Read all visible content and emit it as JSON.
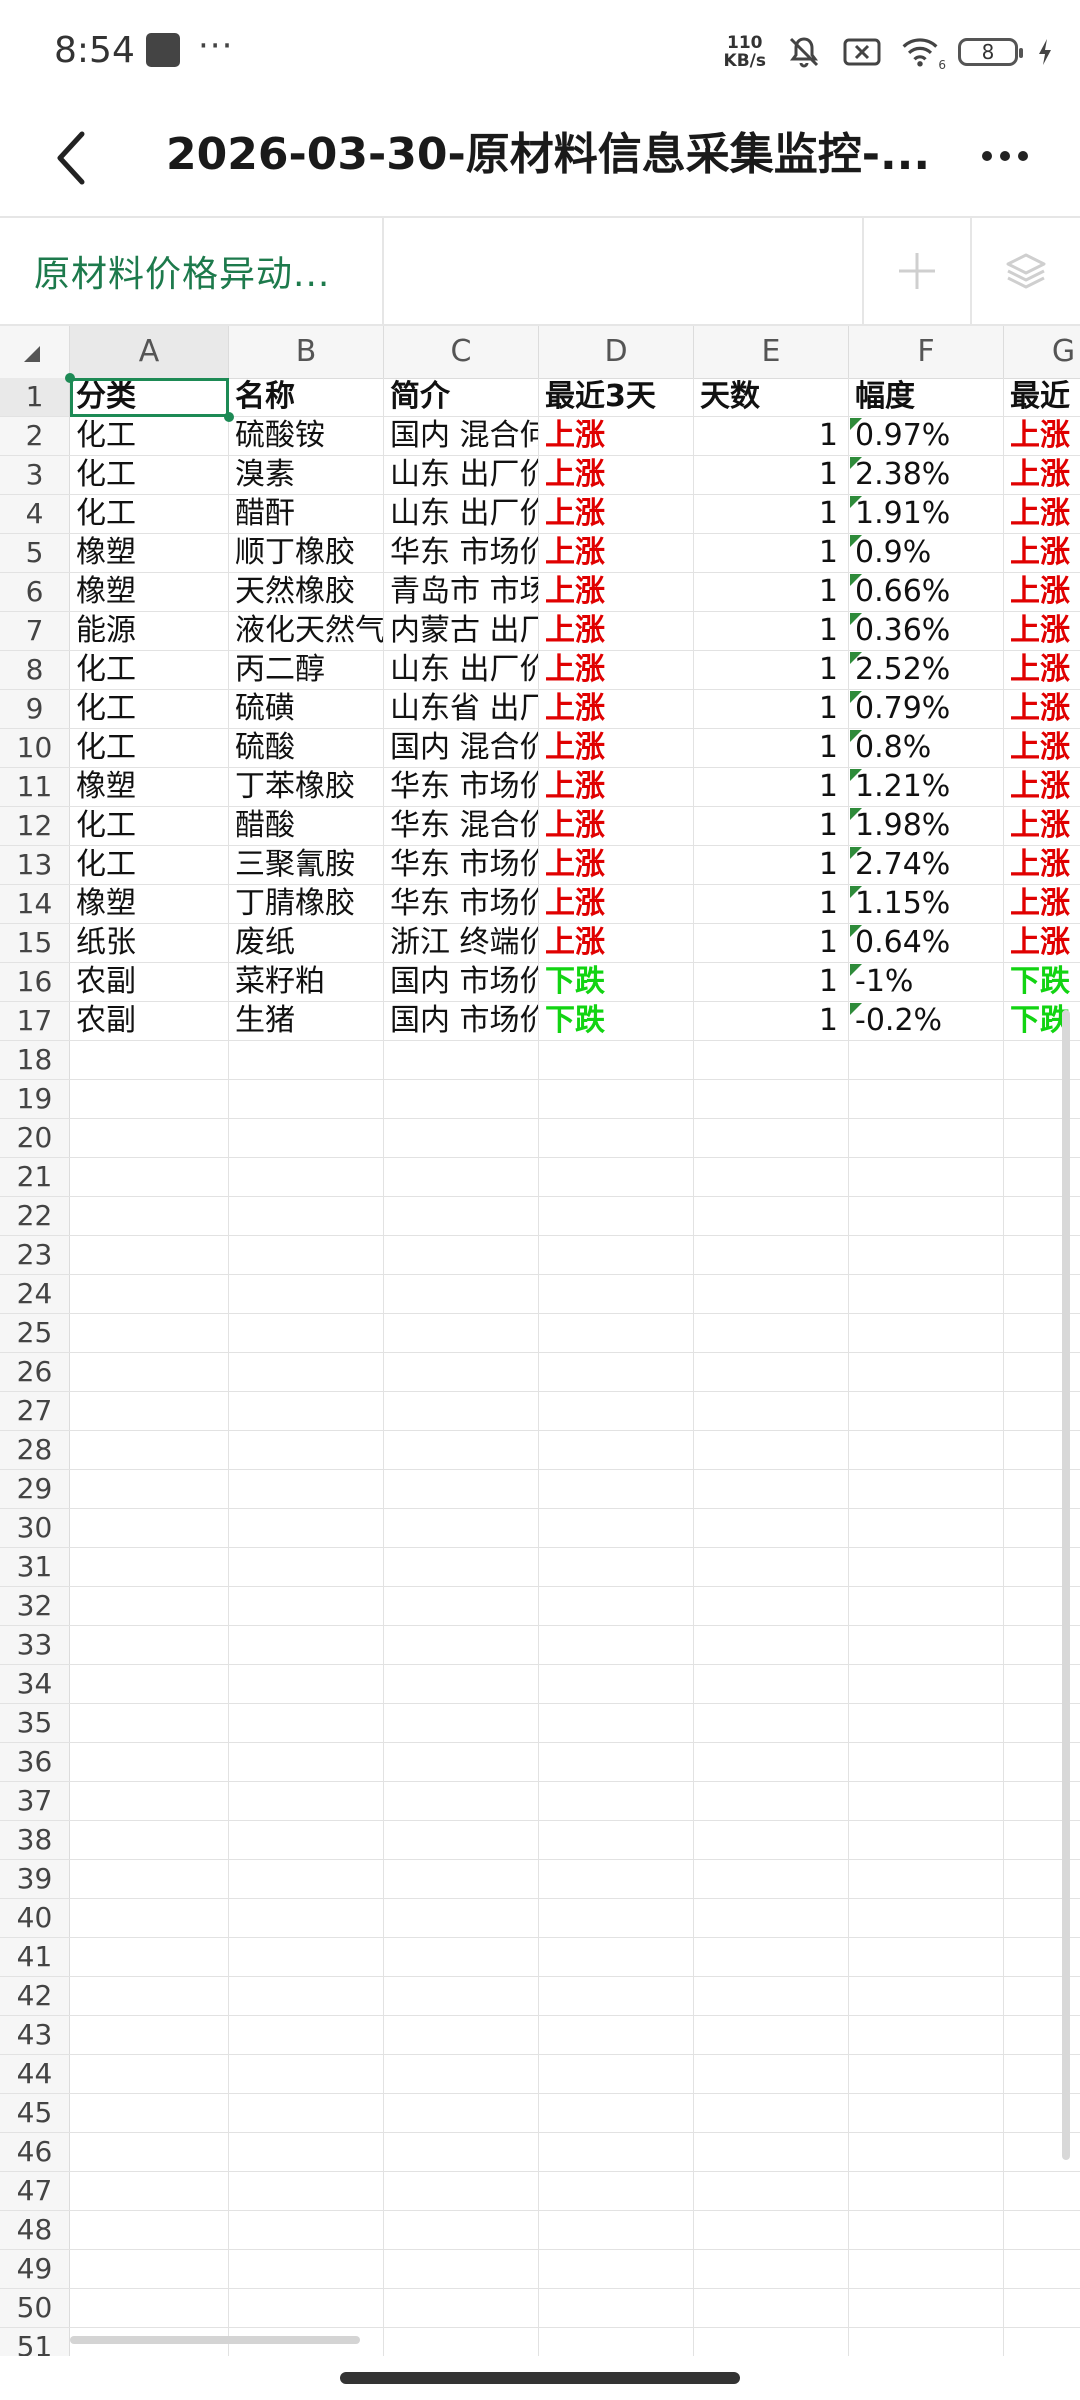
{
  "status_bar": {
    "time": "8:54",
    "dots": "···",
    "speed_value": "110",
    "speed_unit": "KB/s",
    "battery": "8",
    "wifi_badge": "6"
  },
  "header": {
    "title": "2026-03-30-原材料信息采集监控-..."
  },
  "tabs": {
    "active_label": "原材料价格异动..."
  },
  "columns": [
    "A",
    "B",
    "C",
    "D",
    "E",
    "F",
    "G"
  ],
  "table": {
    "headers": [
      "分类",
      "名称",
      "简介",
      "最近3天",
      "天数",
      "幅度",
      "最近"
    ],
    "rows": [
      {
        "cat": "化工",
        "name": "硫酸铵",
        "intro": "国内 混合何",
        "trend": "上涨",
        "days": "1",
        "pct": "0.97%",
        "last": "上涨"
      },
      {
        "cat": "化工",
        "name": "溴素",
        "intro": "山东 出厂价",
        "trend": "上涨",
        "days": "1",
        "pct": "2.38%",
        "last": "上涨"
      },
      {
        "cat": "化工",
        "name": "醋酐",
        "intro": "山东 出厂价",
        "trend": "上涨",
        "days": "1",
        "pct": "1.91%",
        "last": "上涨"
      },
      {
        "cat": "橡塑",
        "name": "顺丁橡胶",
        "intro": "华东 市场价",
        "trend": "上涨",
        "days": "1",
        "pct": "0.9%",
        "last": "上涨"
      },
      {
        "cat": "橡塑",
        "name": "天然橡胶",
        "intro": "青岛市 市场",
        "trend": "上涨",
        "days": "1",
        "pct": "0.66%",
        "last": "上涨"
      },
      {
        "cat": "能源",
        "name": "液化天然气",
        "intro": "内蒙古 出厂",
        "trend": "上涨",
        "days": "1",
        "pct": "0.36%",
        "last": "上涨"
      },
      {
        "cat": "化工",
        "name": "丙二醇",
        "intro": "山东 出厂价",
        "trend": "上涨",
        "days": "1",
        "pct": "2.52%",
        "last": "上涨"
      },
      {
        "cat": "化工",
        "name": "硫磺",
        "intro": "山东省 出厂",
        "trend": "上涨",
        "days": "1",
        "pct": "0.79%",
        "last": "上涨"
      },
      {
        "cat": "化工",
        "name": "硫酸",
        "intro": "国内 混合价",
        "trend": "上涨",
        "days": "1",
        "pct": "0.8%",
        "last": "上涨"
      },
      {
        "cat": "橡塑",
        "name": "丁苯橡胶",
        "intro": "华东 市场价",
        "trend": "上涨",
        "days": "1",
        "pct": "1.21%",
        "last": "上涨"
      },
      {
        "cat": "化工",
        "name": "醋酸",
        "intro": "华东 混合价",
        "trend": "上涨",
        "days": "1",
        "pct": "1.98%",
        "last": "上涨"
      },
      {
        "cat": "化工",
        "name": "三聚氰胺",
        "intro": "华东 市场价",
        "trend": "上涨",
        "days": "1",
        "pct": "2.74%",
        "last": "上涨"
      },
      {
        "cat": "橡塑",
        "name": "丁腈橡胶",
        "intro": "华东 市场价",
        "trend": "上涨",
        "days": "1",
        "pct": "1.15%",
        "last": "上涨"
      },
      {
        "cat": "纸张",
        "name": "废纸",
        "intro": "浙江 终端价",
        "trend": "上涨",
        "days": "1",
        "pct": "0.64%",
        "last": "上涨"
      },
      {
        "cat": "农副",
        "name": "菜籽粕",
        "intro": "国内 市场价",
        "trend": "下跌",
        "days": "1",
        "pct": "-1%",
        "last": "下跌"
      },
      {
        "cat": "农副",
        "name": "生猪",
        "intro": "国内 市场价",
        "trend": "下跌",
        "days": "1",
        "pct": "-0.2%",
        "last": "下跌"
      }
    ]
  },
  "row_numbers": [
    "1",
    "2",
    "3",
    "4",
    "5",
    "6",
    "7",
    "8",
    "9",
    "10",
    "11",
    "12",
    "13",
    "14",
    "15",
    "16",
    "17",
    "18",
    "19",
    "20",
    "21",
    "22",
    "23",
    "24",
    "25",
    "26",
    "27",
    "28",
    "29",
    "30",
    "31",
    "32",
    "33",
    "34",
    "35",
    "36",
    "37",
    "38",
    "39",
    "40",
    "41",
    "42",
    "43",
    "44",
    "45",
    "46",
    "47",
    "48",
    "49",
    "50",
    "51"
  ],
  "colors": {
    "accent": "#1d7a4c",
    "up": "#e00000",
    "down": "#12d412"
  }
}
